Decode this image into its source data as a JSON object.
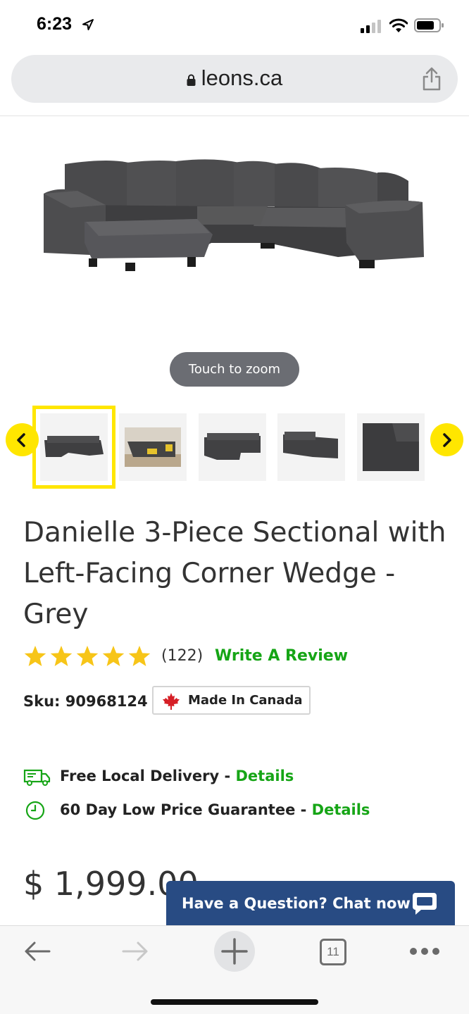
{
  "status_bar": {
    "time": "6:23"
  },
  "browser": {
    "url": "leons.ca",
    "open_tabs": "11"
  },
  "product": {
    "zoom_hint": "Touch to zoom",
    "title": "Danielle 3-Piece Sectional with Left-Facing Corner Wedge - Grey",
    "rating": 5,
    "review_count": "(122)",
    "write_review_label": "Write A Review",
    "sku": "Sku: 90968124",
    "made_in_label": "Made In Canada",
    "price": "$ 1,999.00"
  },
  "features": [
    {
      "label": "Free Local Delivery - ",
      "link": "Details",
      "icon": "delivery-truck-icon"
    },
    {
      "label": "60 Day Low Price Guarantee - ",
      "link": "Details",
      "icon": "clock-icon"
    }
  ],
  "chat": {
    "label": "Have a Question? Chat now"
  },
  "colors": {
    "accent_yellow": "#ffe600",
    "link_green": "#16a516",
    "star_yellow": "#f7c518",
    "chat_blue": "#284b83"
  }
}
